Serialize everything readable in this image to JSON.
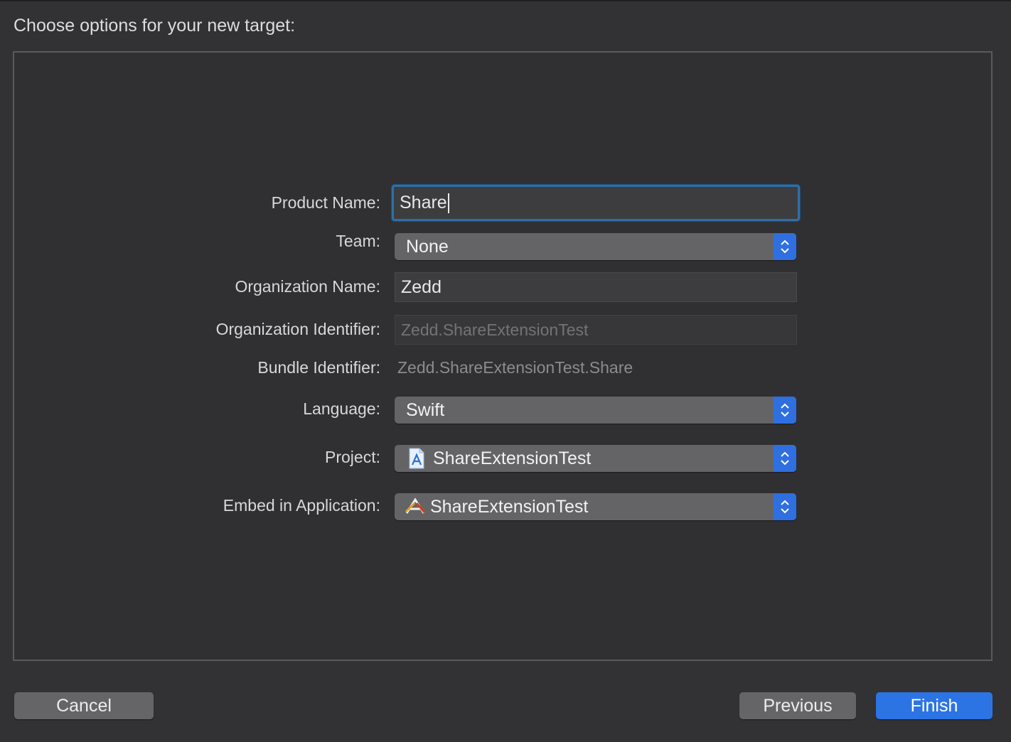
{
  "heading": "Choose options for your new target:",
  "form": {
    "product_name": {
      "label": "Product Name:",
      "value": "Share"
    },
    "team": {
      "label": "Team:",
      "value": "None"
    },
    "organization_name": {
      "label": "Organization Name:",
      "value": "Zedd"
    },
    "organization_identifier": {
      "label": "Organization Identifier:",
      "value": "Zedd.ShareExtensionTest"
    },
    "bundle_identifier": {
      "label": "Bundle Identifier:",
      "value": "Zedd.ShareExtensionTest.Share"
    },
    "language": {
      "label": "Language:",
      "value": "Swift"
    },
    "project": {
      "label": "Project:",
      "value": "ShareExtensionTest",
      "icon": "xcode-project-file-icon"
    },
    "embed": {
      "label": "Embed in Application:",
      "value": "ShareExtensionTest",
      "icon": "app-target-icon"
    }
  },
  "buttons": {
    "cancel": "Cancel",
    "previous": "Previous",
    "finish": "Finish"
  },
  "colors": {
    "accent": "#2c74e4",
    "focus_ring": "#2f6fa7",
    "background": "#323234"
  }
}
